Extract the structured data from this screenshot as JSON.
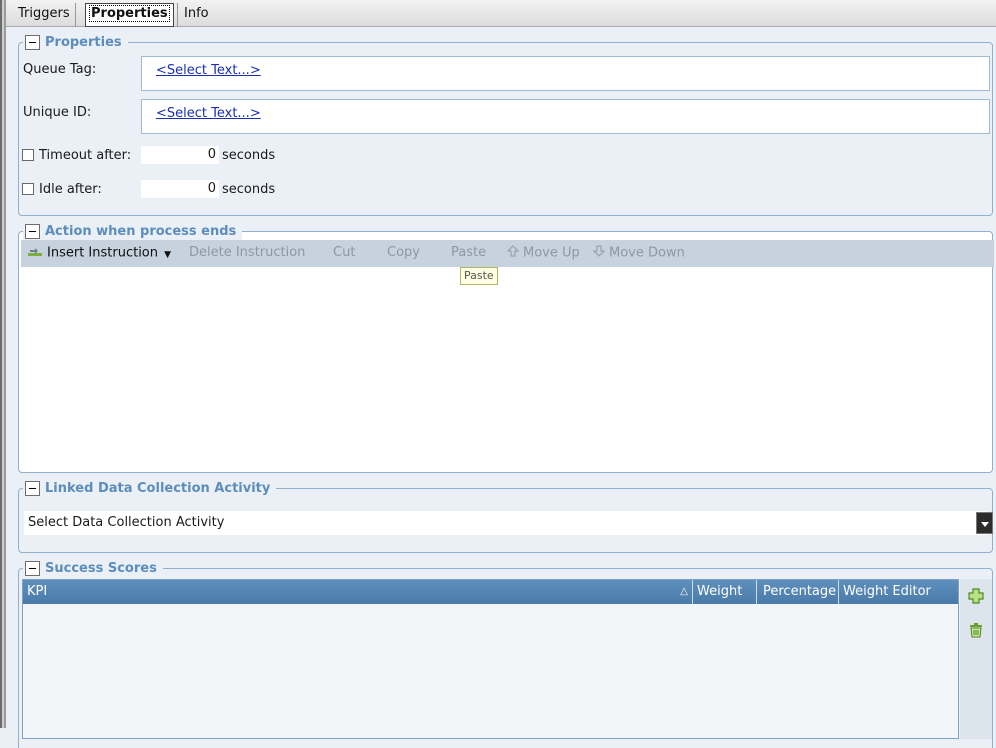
{
  "tabs": [
    "Triggers",
    "Properties",
    "Info"
  ],
  "properties": {
    "title": "Properties",
    "queue_tag_label": "Queue Tag:",
    "queue_tag_value": "<Select Text...>",
    "unique_id_label": "Unique ID:",
    "unique_id_value": "<Select Text...>",
    "timeout_label": "Timeout after:",
    "timeout_value": "0",
    "timeout_unit": "seconds",
    "idle_label": "Idle after:",
    "idle_value": "0",
    "idle_unit": "seconds"
  },
  "action": {
    "title": "Action when process ends",
    "toolbar": {
      "insert": "Insert Instruction",
      "delete": "Delete Instruction",
      "cut": "Cut",
      "copy": "Copy",
      "paste": "Paste",
      "move_up": "Move Up",
      "move_down": "Move Down"
    },
    "tooltip": "Paste"
  },
  "linked": {
    "title": "Linked Data Collection Activity",
    "select_value": "Select Data Collection Activity"
  },
  "scores": {
    "title": "Success Scores",
    "columns": [
      "KPI",
      "Weight",
      "Percentage",
      "Weight Editor"
    ]
  },
  "icons": {
    "insert": "insert-instruction-icon",
    "move_up": "arrow-up-icon",
    "move_down": "arrow-down-icon",
    "add": "add-icon",
    "delete": "trash-icon"
  }
}
